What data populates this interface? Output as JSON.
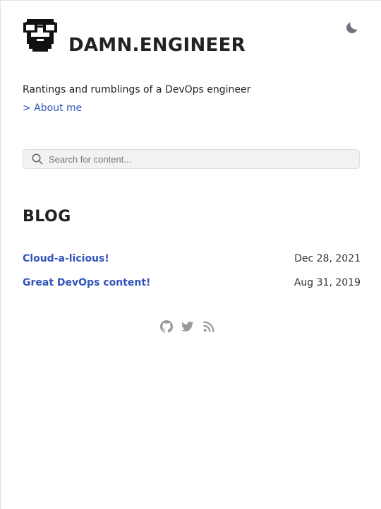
{
  "site": {
    "title": "DAMN.ENGINEER",
    "tagline": "Rantings and rumblings of a DevOps engineer",
    "about_link": "> About me"
  },
  "icons": {
    "logo": "bearded-glasses-avatar-icon",
    "theme_toggle": "moon-icon",
    "search": "search-icon",
    "social": [
      "github-icon",
      "twitter-icon",
      "rss-icon"
    ]
  },
  "search": {
    "placeholder": "Search for content..."
  },
  "blog": {
    "heading": "BLOG",
    "posts": [
      {
        "title": "Cloud-a-licious!",
        "date": "Dec 28, 2021"
      },
      {
        "title": "Great DevOps content!",
        "date": "Aug 31, 2019"
      }
    ]
  },
  "colors": {
    "link": "#3355bb",
    "text": "#222222",
    "icon_gray": "#999999",
    "moon": "#6f7282",
    "search_bg": "#f2f2f2"
  }
}
